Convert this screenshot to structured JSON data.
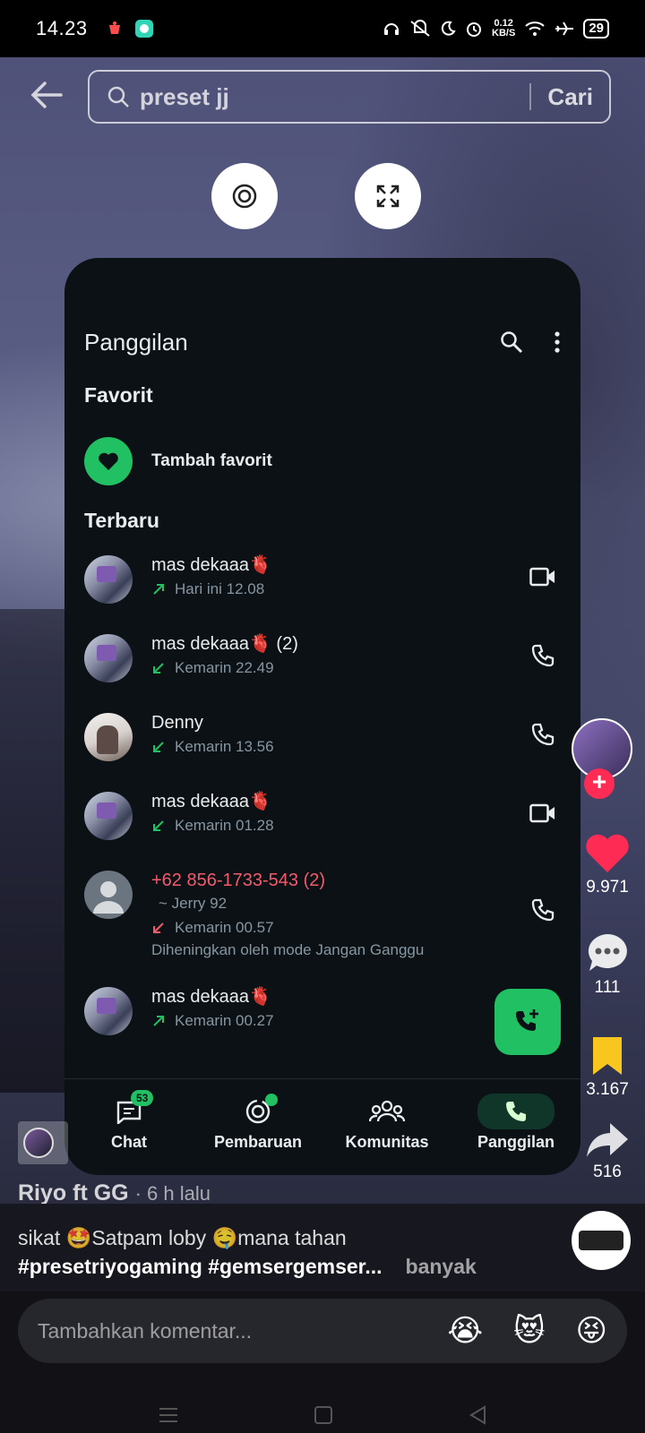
{
  "status_bar": {
    "time": "14.23",
    "net_speed_value": "0.12",
    "net_speed_unit": "KB/S",
    "battery": "29"
  },
  "search": {
    "query": "preset jj",
    "submit_label": "Cari"
  },
  "whatsapp": {
    "title": "Panggilan",
    "favorites_title": "Favorit",
    "add_favorite": "Tambah favorit",
    "recent_title": "Terbaru",
    "calls": [
      {
        "name": "mas dekaaa🫀",
        "direction": "outgoing",
        "time": "Hari ini 12.08",
        "type": "video"
      },
      {
        "name": "mas dekaaa🫀 (2)",
        "direction": "incoming",
        "time": "Kemarin 22.49",
        "type": "voice"
      },
      {
        "name": "Denny",
        "direction": "incoming",
        "time": "Kemarin 13.56",
        "type": "voice"
      },
      {
        "name": "mas dekaaa🫀",
        "direction": "incoming",
        "time": "Kemarin 01.28",
        "type": "video"
      },
      {
        "name": "+62 856-1733-543 (2)",
        "alias": "~ Jerry 92",
        "direction": "missed",
        "time": "Kemarin 00.57",
        "note": "Diheningkan oleh mode Jangan Ganggu",
        "type": "voice"
      },
      {
        "name": "mas dekaaa🫀",
        "direction": "outgoing",
        "time": "Kemarin 00.27",
        "type": "voice"
      }
    ],
    "nav": {
      "chat": "Chat",
      "chat_badge": "53",
      "updates": "Pembaruan",
      "communities": "Komunitas",
      "calls": "Panggilan"
    },
    "accent": "#21c063",
    "missed_color": "#f15c6d"
  },
  "video": {
    "likes": "9.971",
    "comments": "111",
    "saves": "3.167",
    "shares": "516",
    "author": "Riyo ft GG",
    "time_ago": "· 6 h lalu",
    "caption_line1": "sikat 🤩Satpam loby 🤤mana tahan",
    "caption_tags": "#presetriyogaming #gemsergemser...",
    "more_label": "banyak",
    "comment_placeholder": "Tambahkan komentar...",
    "emojis": [
      "😭",
      "😻",
      "😝"
    ]
  }
}
